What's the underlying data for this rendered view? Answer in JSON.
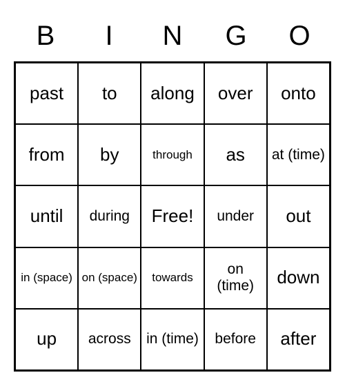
{
  "header": [
    "B",
    "I",
    "N",
    "G",
    "O"
  ],
  "cells": [
    [
      {
        "text": "past",
        "size": "normal"
      },
      {
        "text": "to",
        "size": "normal"
      },
      {
        "text": "along",
        "size": "normal"
      },
      {
        "text": "over",
        "size": "normal"
      },
      {
        "text": "onto",
        "size": "normal"
      }
    ],
    [
      {
        "text": "from",
        "size": "normal"
      },
      {
        "text": "by",
        "size": "normal"
      },
      {
        "text": "through",
        "size": "small"
      },
      {
        "text": "as",
        "size": "normal"
      },
      {
        "text": "at (time)",
        "size": "medium"
      }
    ],
    [
      {
        "text": "until",
        "size": "normal"
      },
      {
        "text": "during",
        "size": "medium"
      },
      {
        "text": "Free!",
        "size": "normal"
      },
      {
        "text": "under",
        "size": "medium"
      },
      {
        "text": "out",
        "size": "normal"
      }
    ],
    [
      {
        "text": "in (space)",
        "size": "small"
      },
      {
        "text": "on (space)",
        "size": "small"
      },
      {
        "text": "towards",
        "size": "small"
      },
      {
        "text": "on (time)",
        "size": "medium"
      },
      {
        "text": "down",
        "size": "normal"
      }
    ],
    [
      {
        "text": "up",
        "size": "normal"
      },
      {
        "text": "across",
        "size": "medium"
      },
      {
        "text": "in (time)",
        "size": "medium"
      },
      {
        "text": "before",
        "size": "medium"
      },
      {
        "text": "after",
        "size": "normal"
      }
    ]
  ]
}
